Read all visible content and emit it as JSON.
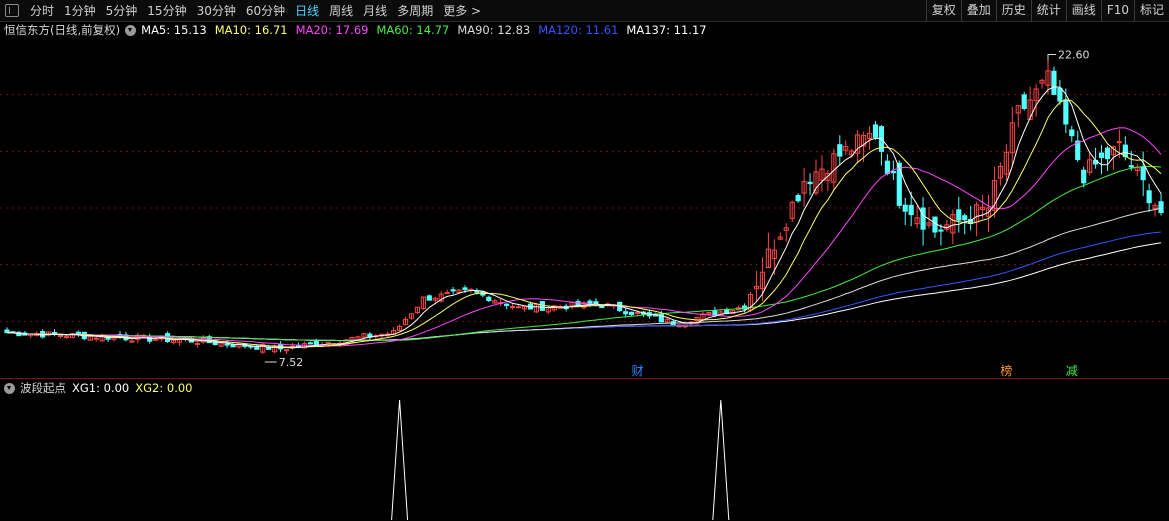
{
  "toolbar": {
    "periods": [
      "分时",
      "1分钟",
      "5分钟",
      "15分钟",
      "30分钟",
      "60分钟",
      "日线",
      "周线",
      "月线",
      "多周期",
      "更多 >"
    ],
    "active": "日线",
    "right_buttons": [
      "复权",
      "叠加",
      "历史",
      "统计",
      "画线",
      "F10",
      "标记"
    ]
  },
  "header": {
    "stock_name": "恒信东方(日线,前复权)",
    "ma_items": [
      {
        "label": "MA5: 15.13",
        "color": "#ffffff"
      },
      {
        "label": "MA10: 16.71",
        "color": "#ffff66"
      },
      {
        "label": "MA20: 17.69",
        "color": "#ff44ff"
      },
      {
        "label": "MA60: 14.77",
        "color": "#44ee44"
      },
      {
        "label": "MA90: 12.83",
        "color": "#dcdcdc"
      },
      {
        "label": "MA120: 11.61",
        "color": "#3355ff"
      },
      {
        "label": "MA137: 11.17",
        "color": "#ffffff"
      }
    ]
  },
  "sub": {
    "name": "波段起点",
    "xg1": "XG1: 0.00",
    "xg2": "XG2: 0.00",
    "xg1_color": "#ffffff",
    "xg2_color": "#ffff66"
  },
  "colors": {
    "up": "#ff4444",
    "down": "#54ffff",
    "grid": "#7a1010",
    "ma5": "#ffffff",
    "ma10": "#ffff66",
    "ma20": "#ff44ff",
    "ma60": "#44ee44",
    "ma90": "#dcdcdc",
    "ma120": "#3355ff",
    "ma137": "#ffffff",
    "marker_cai": "#2f86ff",
    "marker_bang": "#ff9a2a",
    "marker_jian": "#44ee44"
  },
  "chart_data": {
    "type": "candlestick",
    "y_range": [
      6.0,
      24.0
    ],
    "price_levels": [
      3.0,
      6.0,
      9.0,
      12.0,
      15.0,
      18.0,
      21.0
    ],
    "high_label": "22.60",
    "low_label": "7.52",
    "event_markers": [
      {
        "text": "财",
        "bar": 106
      },
      {
        "text": "榜",
        "bar": 168
      },
      {
        "text": "减",
        "bar": 179
      }
    ],
    "candles": [],
    "ma5": [],
    "ma10": [],
    "ma20": [],
    "ma60": [],
    "ma90": [],
    "ma120": [],
    "ma137": [],
    "signals": [
      66,
      120
    ]
  }
}
